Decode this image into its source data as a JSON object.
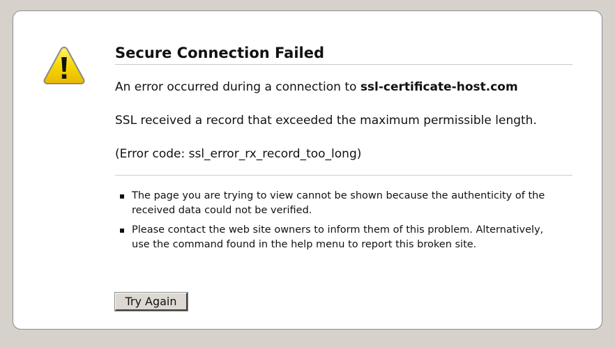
{
  "error": {
    "title": "Secure Connection Failed",
    "intro_prefix": "An error occurred during a connection to",
    "host": "ssl-certificate-host.com",
    "message": "SSL received a record that exceeded the maximum permissible length.",
    "error_code": "(Error code: ssl_error_rx_record_too_long)",
    "icon": "warning-triangle-icon",
    "icon_color": "#f3c800",
    "bullets": [
      "The page you are trying to view cannot be shown because the authenticity of the received data could not be verified.",
      "Please contact the web site owners to inform them of this problem. Alternatively, use the command found in the help menu to report this broken site."
    ],
    "button_label": "Try Again"
  }
}
